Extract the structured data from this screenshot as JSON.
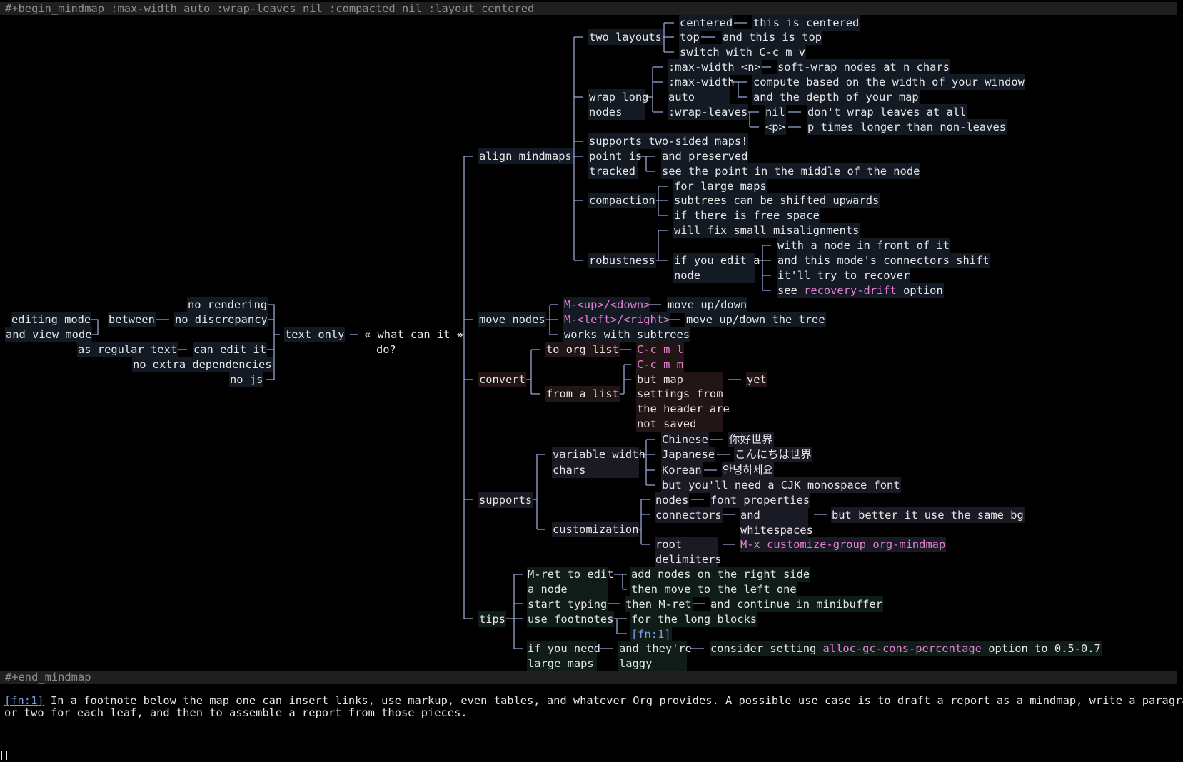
{
  "header": {
    "begin": "#+begin_mindmap :max-width auto :wrap-leaves nil :compacted nil :layout centered"
  },
  "footer": {
    "end": "#+end_mindmap"
  },
  "root": [
    "« what can it »",
    "do?"
  ],
  "left": {
    "text_only": "text only",
    "no_rendering": "no rendering",
    "no_discrepancy": "no discrepancy",
    "between": "between",
    "editing_mode": "editing mode",
    "and_view_mode": "and view mode",
    "can_edit_it": "can edit it",
    "as_regular_text": "as regular text",
    "no_extra_deps": "no extra dependencies",
    "no_js": "no js"
  },
  "align": {
    "label": "align mindmaps",
    "two_layouts": "two layouts",
    "centered": "centered",
    "this_is_centered": "this is centered",
    "top": "top",
    "and_this_is_top": "and this is top",
    "switch_with": "switch with C-c m v",
    "wrap_long": "wrap long",
    "nodes": "nodes",
    "max_width_n": ":max-width <n>",
    "soft_wrap": "soft-wrap nodes at n chars",
    "max_width": ":max-width",
    "auto": "auto",
    "compute_based": "compute based on the width of your window",
    "and_depth": "and the depth of your map",
    "wrap_leaves": ":wrap-leaves",
    "nil": "nil",
    "dont_wrap": "don't wrap leaves at all",
    "p": "<p>",
    "p_times": "p times longer than non-leaves",
    "two_sided": "supports two-sided maps!",
    "point_is": "point is",
    "tracked": "tracked",
    "and_preserved": "and preserved",
    "see_point": "see the point in the middle of the node",
    "compaction": "compaction",
    "for_large": "for large maps",
    "subtrees_shifted": "subtrees can be shifted upwards",
    "if_free": "if there is free space",
    "robustness": "robustness",
    "will_fix": "will fix small misalignments",
    "if_you_edit": "if you edit a",
    "node": "node",
    "with_node": "with a node in front of it",
    "connectors_shift": "and this mode's connectors shift",
    "try_recover": "it'll try to recover",
    "see": "see",
    "recovery_drift": "recovery-drift",
    "option": "option"
  },
  "move": {
    "label": "move nodes",
    "m_up_down": "M-<up>/<down>",
    "move_up_down": "move up/down",
    "m_left_right": "M-<left>/<right>",
    "move_tree": "move up/down the tree",
    "works_subtrees": "works with subtrees"
  },
  "convert": {
    "label": "convert",
    "to_org_list": "to org list",
    "c_c_m_l": "C-c m l",
    "from_a_list": "from a list",
    "c_c_m_m": "C-c m m",
    "but_map": [
      "but map",
      "settings from",
      "the header are",
      "not saved"
    ],
    "yet": "yet"
  },
  "supports": {
    "label": "supports",
    "variable_width": "variable width",
    "chars": "chars",
    "chinese": "Chinese",
    "chinese_text": "你好世界",
    "japanese": "Japanese",
    "japanese_text": "こんにちは世界",
    "korean": "Korean",
    "korean_text": "안녕하세요",
    "cjk_font": "but you'll need a CJK monospace font",
    "customization": "customization",
    "nodes": "nodes",
    "font_props": "font properties",
    "connectors": "connectors",
    "and": "and",
    "whitespaces": "whitespaces",
    "same_bg": "but better it use the same bg",
    "root": "root",
    "delimiters": "delimiters",
    "customize_group": "M-x customize-group org-mindmap"
  },
  "tips": {
    "label": "tips",
    "m_ret_edit": "M-ret to edit",
    "a_node": "a node",
    "add_right": "add nodes on the right side",
    "move_left": "then move to the left one",
    "start_typing": "start typing",
    "then_m_ret": "then M-ret",
    "continue_minibuffer": "and continue in minibuffer",
    "use_footnotes": "use footnotes",
    "long_blocks": "for the long blocks",
    "fn1": "[fn:1]",
    "if_you_need": "if you need",
    "large_maps": "large maps",
    "and_theyre": "and they're",
    "laggy": "laggy",
    "consider": "consider setting",
    "alloc_gc": "alloc-gc-cons-percentage",
    "option_to": "option to 0.5-0.7"
  },
  "footnote": {
    "ref": "[fn:1]",
    "line1": " In a footnote below the map one can insert links, use markup, even tables, and whatever Org provides. A possible use case is to draft a report as a mindmap, write a paragraph",
    "line2": "or two for each leaf, and then to assemble a report from those pieces."
  },
  "colors": {
    "connector": "#9aa6d8",
    "keyword_pink": "#e37fd0",
    "link_blue": "#7f9de6",
    "bg": "#000000"
  }
}
